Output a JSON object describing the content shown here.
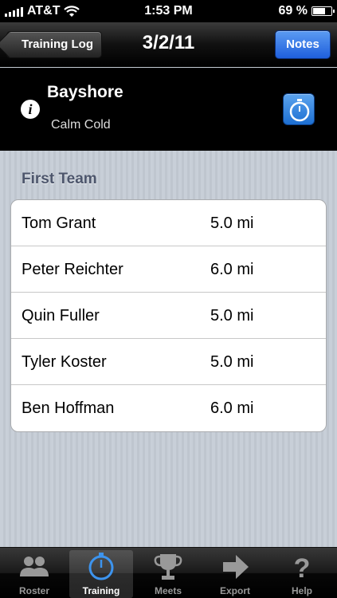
{
  "status_bar": {
    "carrier": "AT&T",
    "time": "1:53 PM",
    "battery": "69 %",
    "battery_level": 0.69
  },
  "nav": {
    "back_label": "Training Log",
    "title": "3/2/11",
    "notes_label": "Notes"
  },
  "header": {
    "location": "Bayshore",
    "conditions": "Calm Cold",
    "info_icon": "info-icon",
    "timer_icon": "stopwatch-icon"
  },
  "section": {
    "title": "First Team"
  },
  "athletes": [
    {
      "name": "Tom Grant",
      "distance": "5.0 mi"
    },
    {
      "name": "Peter Reichter",
      "distance": "6.0 mi"
    },
    {
      "name": "Quin Fuller",
      "distance": "5.0 mi"
    },
    {
      "name": "Tyler Koster",
      "distance": "5.0 mi"
    },
    {
      "name": "Ben Hoffman",
      "distance": "6.0 mi"
    }
  ],
  "tabs": [
    {
      "label": "Roster",
      "icon": "people-icon"
    },
    {
      "label": "Training",
      "icon": "stopwatch-icon",
      "active": true
    },
    {
      "label": "Meets",
      "icon": "trophy-icon"
    },
    {
      "label": "Export",
      "icon": "arrow-right-icon"
    },
    {
      "label": "Help",
      "icon": "question-icon"
    }
  ],
  "colors": {
    "accent": "#2f75e6",
    "section_title": "#4d566c",
    "background": "#c5ccd4"
  }
}
